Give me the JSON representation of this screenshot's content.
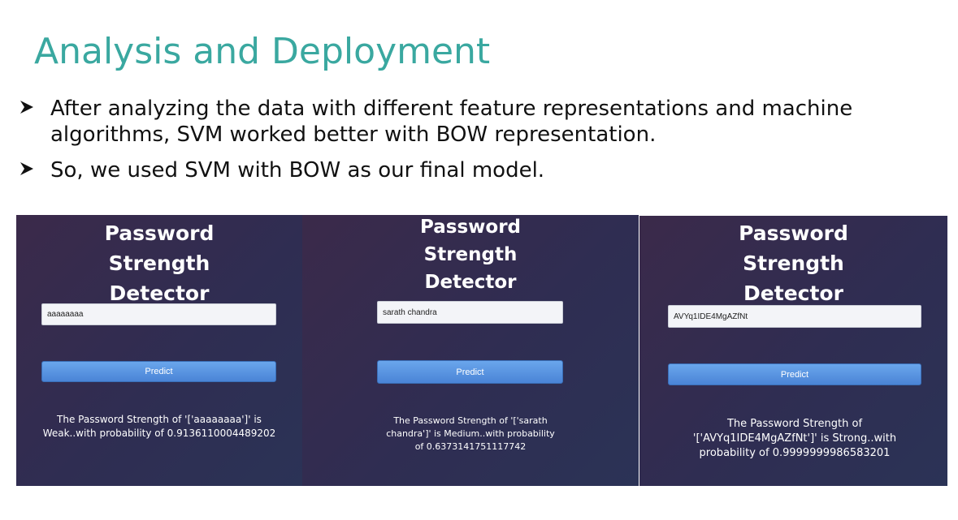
{
  "slide": {
    "title": "Analysis and Deployment",
    "bullets": [
      "After analyzing the data with different feature representations and machine algorithms, SVM worked better with BOW representation.",
      "So, we used SVM with BOW as our final model."
    ]
  },
  "colors": {
    "title": "#3aa8a0",
    "panel_bg": "#302d52",
    "button": "#5592e0"
  },
  "panels": [
    {
      "title": "Password Strength Detector",
      "input_value": "aaaaaaaa",
      "button_label": "Predict",
      "result": "The Password Strength of '['aaaaaaaa']' is Weak..with probability of 0.9136110004489202"
    },
    {
      "title": "Password Strength Detector",
      "input_value": "sarath chandra",
      "button_label": "Predict",
      "result": "The Password Strength of '['sarath chandra']' is Medium..with probability of 0.6373141751117742"
    },
    {
      "title": "Password Strength Detector",
      "input_value": "AVYq1IDE4MgAZfNt",
      "button_label": "Predict",
      "result": "The Password Strength of '['AVYq1IDE4MgAZfNt']' is Strong..with probability of 0.9999999986583201"
    }
  ]
}
